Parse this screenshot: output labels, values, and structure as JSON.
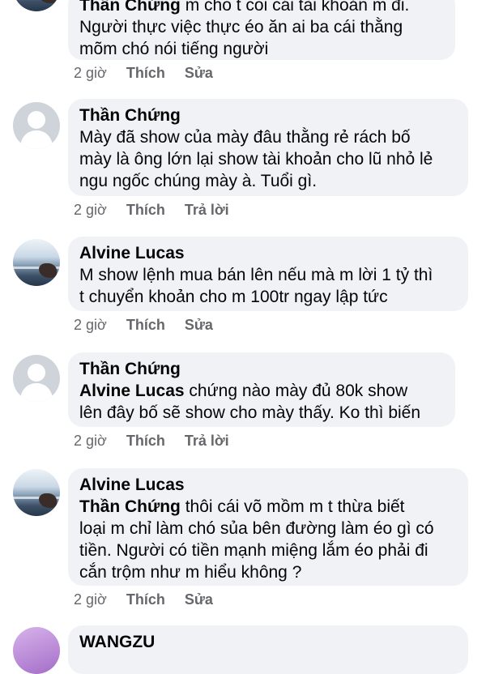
{
  "comments": [
    {
      "name": "Thần Chứng",
      "lines": [
        "m cho t coi cái tài khoản m đi.",
        "Người thực việc thực éo ăn ai ba cái thằng",
        "mõm chó nói tiếng người"
      ],
      "meta": {
        "time": "2 giờ",
        "like": "Thích",
        "action": "Sửa"
      }
    },
    {
      "name": "Thần Chứng",
      "lines": [
        "Mày đã show của mày đâu thằng rẻ rách bố",
        "mày là ông lớn lại show tài khoản cho lũ nhỏ lẻ",
        "ngu ngốc chúng mày à. Tuổi gì."
      ],
      "meta": {
        "time": "2 giờ",
        "like": "Thích",
        "action": "Trả lời"
      }
    },
    {
      "name": "Alvine Lucas",
      "lines": [
        "M show lệnh mua bán lên nếu mà m lời 1 tỷ thì",
        "t chuyển khoản cho m 100tr ngay lập tức"
      ],
      "meta": {
        "time": "2 giờ",
        "like": "Thích",
        "action": "Sửa"
      }
    },
    {
      "name": "Thần Chứng",
      "mention": "Alvine Lucas",
      "lines": [
        " chứng nào mày đủ 80k show",
        "lên đây bố sẽ show cho mày thấy. Ko thì biến"
      ],
      "meta": {
        "time": "2 giờ",
        "like": "Thích",
        "action": "Trả lời"
      }
    },
    {
      "name": "Alvine Lucas",
      "mention": "Thần Chứng",
      "lines": [
        " thôi cái võ mồm m t thừa biết",
        "loại m chỉ làm chó sủa bên đường làm éo gì có",
        "tiền. Người có tiền mạnh miệng lắm éo phải đi",
        "cắn trộm như m hiểu không ?"
      ],
      "meta": {
        "time": "2 giờ",
        "like": "Thích",
        "action": "Sửa"
      }
    },
    {
      "name": "WANGZU"
    }
  ]
}
